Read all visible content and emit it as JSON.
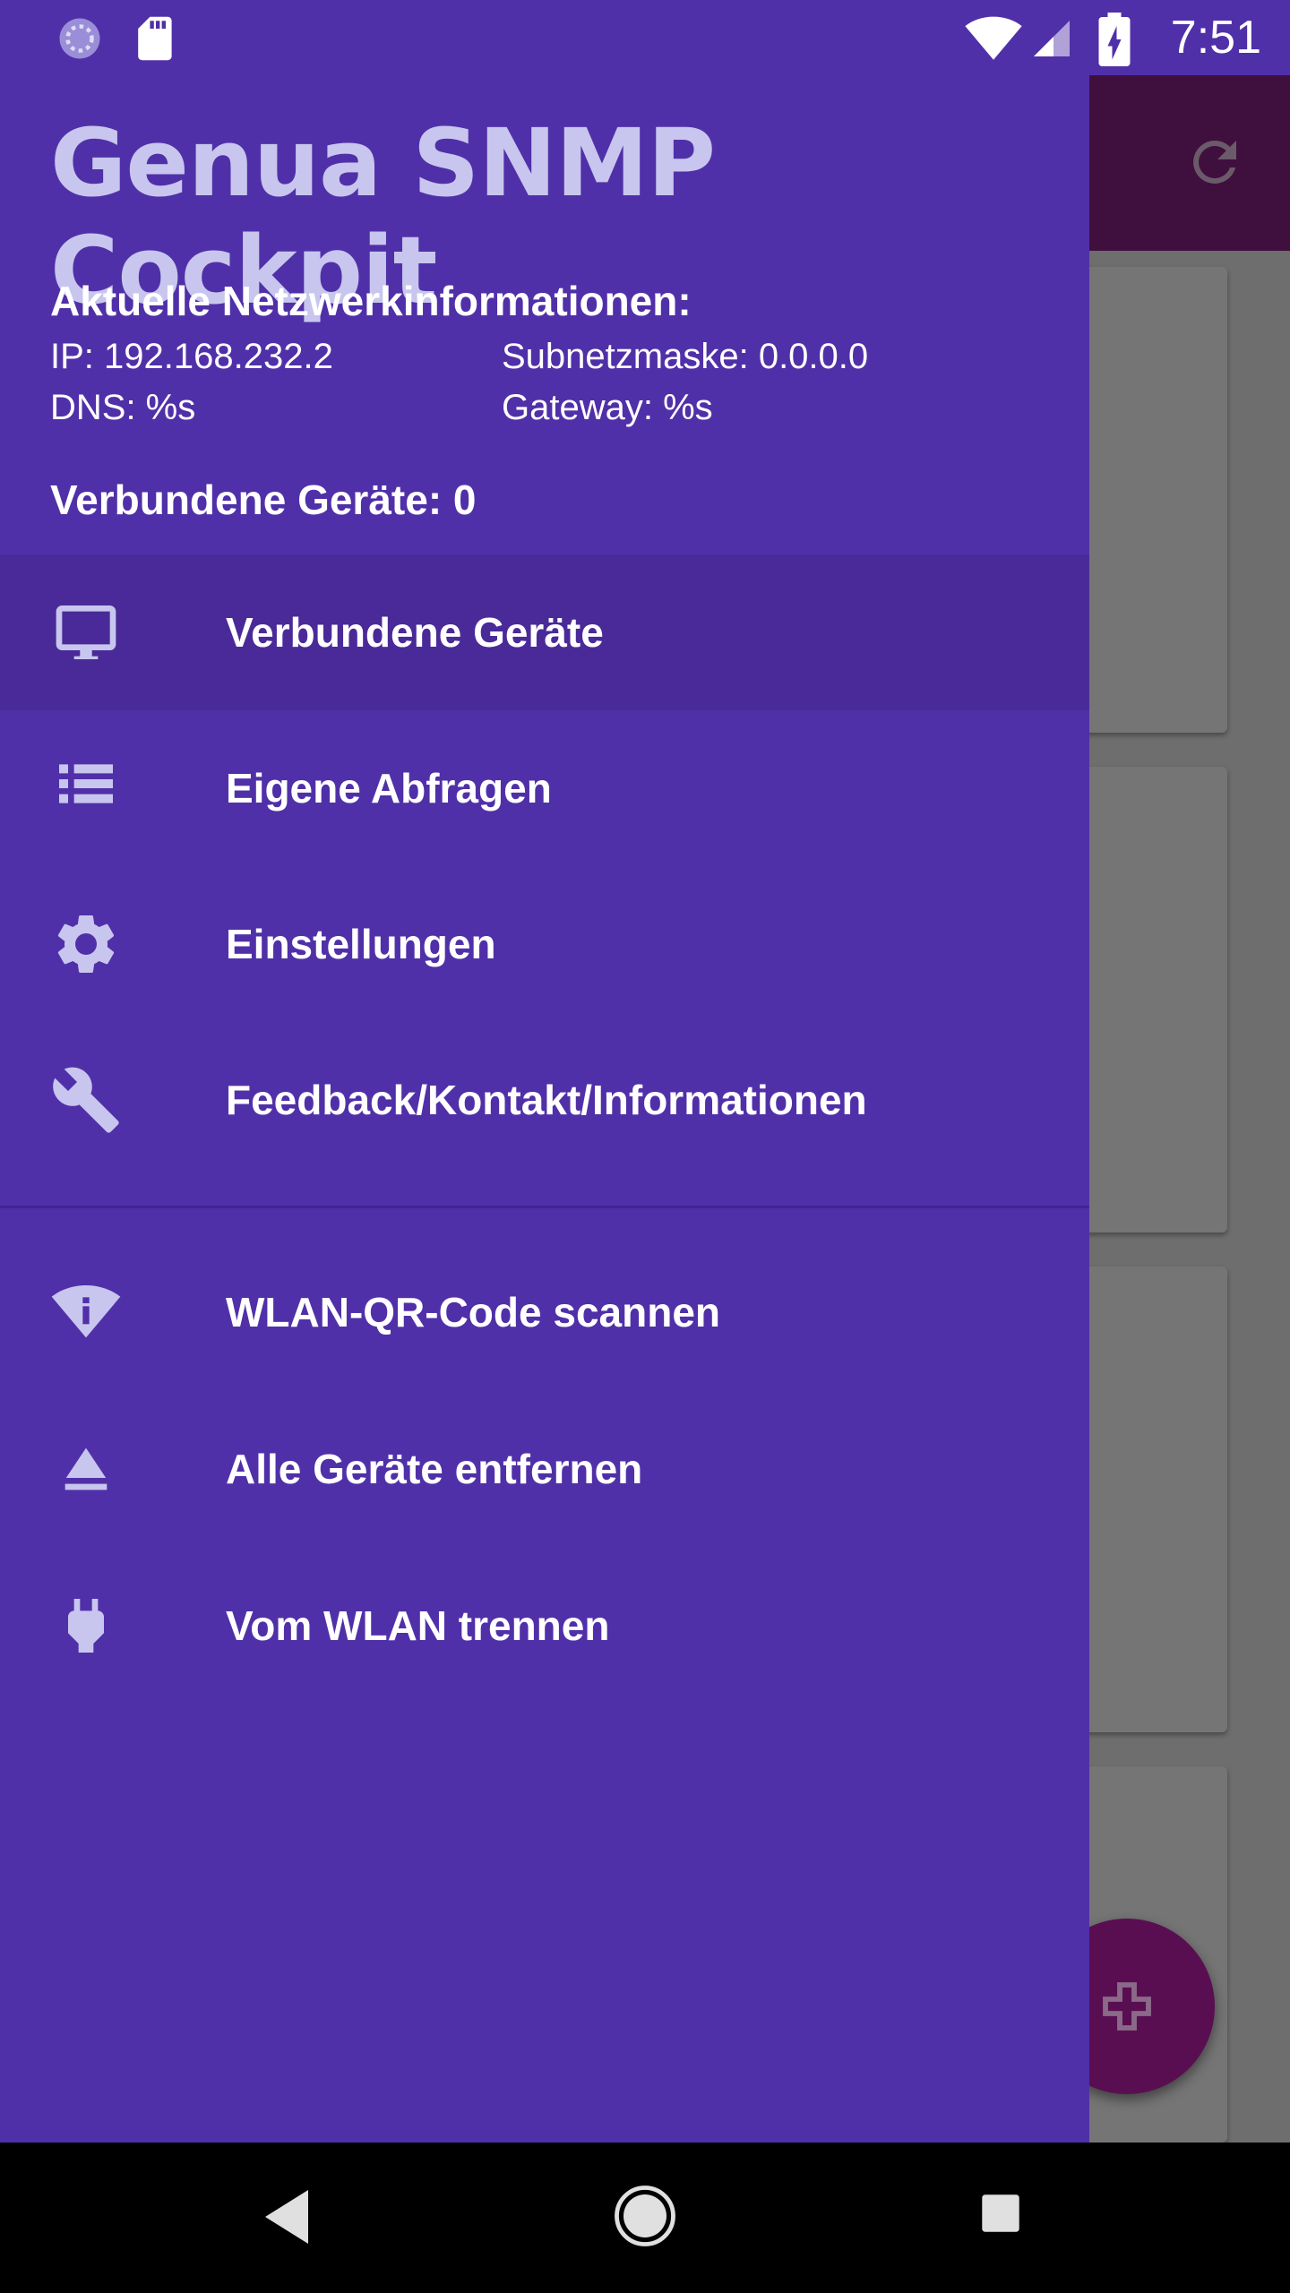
{
  "status_bar": {
    "time": "7:51",
    "left_icons": [
      "sync-icon",
      "sd-card-icon"
    ],
    "right_icons": [
      "wifi-icon",
      "cell-signal-icon",
      "battery-charging-icon"
    ]
  },
  "drawer": {
    "app_title": "Genua SNMP Cockpit",
    "network_info": {
      "heading": "Aktuelle Netzwerkinformationen:",
      "ip": "IP: 192.168.232.2",
      "subnet": "Subnetzmaske: 0.0.0.0",
      "dns": "DNS: %s",
      "gateway": "Gateway: %s"
    },
    "connected_devices": "Verbundene Geräte: 0",
    "menu_items": [
      {
        "label": "Verbundene Geräte",
        "icon": "monitor-icon",
        "active": true
      },
      {
        "label": "Eigene Abfragen",
        "icon": "list-icon",
        "active": false
      },
      {
        "label": "Einstellungen",
        "icon": "gear-icon",
        "active": false
      },
      {
        "label": "Feedback/Kontakt/Informationen",
        "icon": "wrench-icon",
        "active": false
      }
    ],
    "secondary_items": [
      {
        "label": "WLAN-QR-Code scannen",
        "icon": "wifi-info-icon"
      },
      {
        "label": "Alle Geräte entfernen",
        "icon": "eject-icon"
      },
      {
        "label": "Vom WLAN trennen",
        "icon": "plug-icon"
      }
    ]
  },
  "background_app": {
    "toolbar_icons": [
      "refresh-icon"
    ],
    "fab_icon": "add-icon"
  },
  "nav_bar": {
    "buttons": [
      "back-icon",
      "home-icon",
      "recents-icon"
    ]
  },
  "colors": {
    "drawer_bg": "#5030a8",
    "active_item_bg": "#4a2a98",
    "title_color": "#c8c6ee",
    "bg_toolbar": "#3f0f3d",
    "fab": "#5a0e52"
  }
}
